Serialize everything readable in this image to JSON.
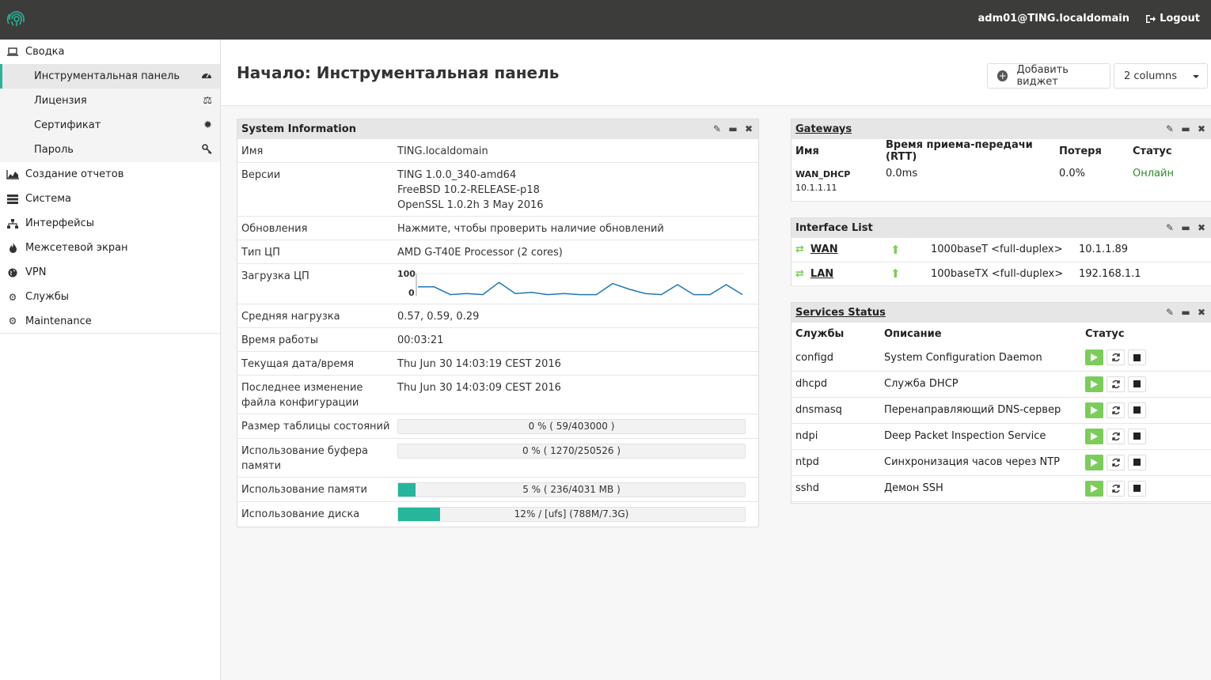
{
  "topbar": {
    "user": "adm01@TING.localdomain",
    "logout": "Logout"
  },
  "sidebar": {
    "items": [
      {
        "label": "Сводка",
        "icon": "laptop-icon"
      },
      {
        "label": "Инструментальная панель",
        "icon": "dashboard-icon",
        "sub": true,
        "active": true
      },
      {
        "label": "Лицензия",
        "icon": "scale-icon",
        "sub": true
      },
      {
        "label": "Сертификат",
        "icon": "certificate-icon",
        "sub": true
      },
      {
        "label": "Пароль",
        "icon": "key-icon",
        "sub": true
      },
      {
        "label": "Создание отчетов",
        "icon": "area-chart-icon"
      },
      {
        "label": "Система",
        "icon": "server-icon"
      },
      {
        "label": "Интерфейсы",
        "icon": "sitemap-icon"
      },
      {
        "label": "Межсетевой экран",
        "icon": "fire-icon"
      },
      {
        "label": "VPN",
        "icon": "globe-icon"
      },
      {
        "label": "Службы",
        "icon": "gear-icon"
      },
      {
        "label": "Maintenance",
        "icon": "gears-icon"
      }
    ]
  },
  "header": {
    "title": "Начало: Инструментальная панель",
    "add_widget": "Добавить виджет",
    "columns": "2 columns"
  },
  "system_info": {
    "title": "System Information",
    "rows": {
      "name_k": "Имя",
      "name_v": "TING.localdomain",
      "ver_k": "Версии",
      "ver_v1": "TING 1.0.0_340-amd64",
      "ver_v2": "FreeBSD 10.2-RELEASE-p18",
      "ver_v3": "OpenSSL 1.0.2h 3 May 2016",
      "upd_k": "Обновления",
      "upd_v": "Нажмите, чтобы проверить наличие обновлений",
      "cpu_k": "Тип ЦП",
      "cpu_v": "AMD G-T40E Processor (2 cores)",
      "load_k": "Загрузка ЦП",
      "load_max": "100",
      "load_min": "0",
      "avg_k": "Средняя нагрузка",
      "avg_v": "0.57, 0.59, 0.29",
      "up_k": "Время работы",
      "up_v": "00:03:21",
      "dt_k": "Текущая дата/время",
      "dt_v": "Thu Jun 30 14:03:19 CEST 2016",
      "cfg_k": "Последнее изменение файла конфигурации",
      "cfg_v": "Thu Jun 30 14:03:09 CEST 2016",
      "state_k": "Размер таблицы состояний",
      "state_v": "0 % ( 59/403000 )",
      "mbuf_k": "Использование буфера памяти",
      "mbuf_v": "0 % ( 1270/250526 )",
      "mem_k": "Использование памяти",
      "mem_v": "5 % ( 236/4031 MB )",
      "disk_k": "Использование диска",
      "disk_v": "12% / [ufs] (788M/7.3G)"
    },
    "cpu_series": [
      40,
      40,
      5,
      10,
      5,
      60,
      10,
      15,
      5,
      10,
      5,
      5,
      55,
      30,
      10,
      5,
      50,
      5,
      5,
      50,
      5
    ],
    "bars": {
      "state": 0,
      "mbuf": 0,
      "mem": 5,
      "disk": 12
    }
  },
  "gateways": {
    "title": "Gateways",
    "headers": [
      "Имя",
      "Время приема-передачи (RTT)",
      "Потеря",
      "Статус"
    ],
    "rows": [
      {
        "name": "WAN_DHCP",
        "ip": "10.1.1.11",
        "rtt": "0.0ms",
        "loss": "0.0%",
        "status": "Онлайн"
      }
    ]
  },
  "interfaces": {
    "title": "Interface List",
    "rows": [
      {
        "name": "WAN",
        "media": "1000baseT <full-duplex>",
        "ip": "10.1.1.89"
      },
      {
        "name": "LAN",
        "media": "100baseTX <full-duplex>",
        "ip": "192.168.1.1"
      }
    ]
  },
  "services": {
    "title": "Services Status",
    "headers": [
      "Службы",
      "Описание",
      "Статус"
    ],
    "rows": [
      {
        "name": "configd",
        "desc": "System Configuration Daemon"
      },
      {
        "name": "dhcpd",
        "desc": "Служба DHCP"
      },
      {
        "name": "dnsmasq",
        "desc": "Перенаправляющий DNS-сервер"
      },
      {
        "name": "ndpi",
        "desc": "Deep Packet Inspection Service"
      },
      {
        "name": "ntpd",
        "desc": "Синхронизация часов через NTP"
      },
      {
        "name": "sshd",
        "desc": "Демон SSH"
      }
    ]
  },
  "colors": {
    "accent": "#2bb39a",
    "topbar": "#3c3c3a",
    "online": "#2e8b2e",
    "play": "#7ccc5c"
  }
}
